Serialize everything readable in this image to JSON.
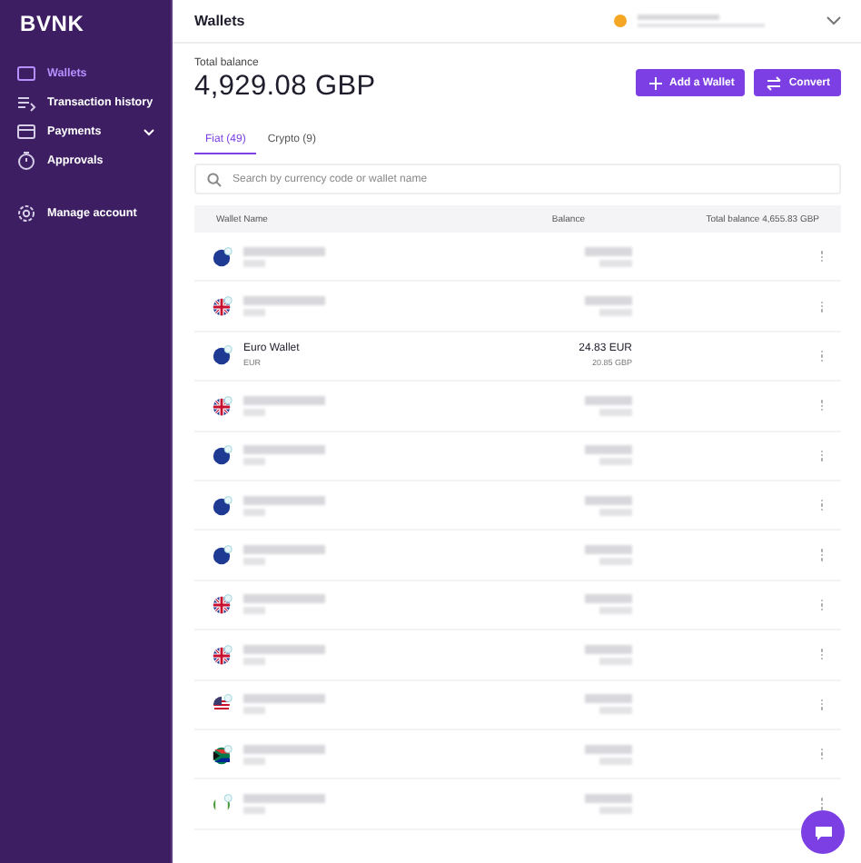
{
  "sidebar": {
    "logo": "BVNK",
    "items": [
      {
        "label": "Wallets",
        "selected": true,
        "expandable": false
      },
      {
        "label": "Transaction history",
        "selected": false,
        "expandable": false
      },
      {
        "label": "Payments",
        "selected": false,
        "expandable": true
      },
      {
        "label": "Approvals",
        "selected": false,
        "expandable": false
      }
    ],
    "footer_items": [
      {
        "label": "Manage account",
        "selected": false,
        "expandable": false
      }
    ]
  },
  "header": {
    "title": "Wallets",
    "account_redacted": true
  },
  "summary": {
    "label": "Total balance",
    "amount": "4,929.08 GBP"
  },
  "buttons": [
    {
      "label": "Add a Wallet"
    },
    {
      "label": "Convert"
    }
  ],
  "tabs": [
    {
      "label": "Fiat (49)",
      "selected": true
    },
    {
      "label": "Crypto (9)",
      "selected": false
    }
  ],
  "search": {
    "placeholder": "Search by currency code or wallet name"
  },
  "table": {
    "columns": [
      "Wallet Name",
      "Balance",
      "Total balance 4,655.83 GBP"
    ],
    "rows": [
      {
        "kind": "eu",
        "redacted": true
      },
      {
        "kind": "uk",
        "redacted": true
      },
      {
        "kind": "eu",
        "redacted": false,
        "name": "Euro Wallet",
        "currency": "EUR",
        "balance": "24.83 EUR",
        "converted": "20.85 GBP"
      },
      {
        "kind": "uk",
        "redacted": true
      },
      {
        "kind": "eu",
        "redacted": true
      },
      {
        "kind": "eu",
        "redacted": true
      },
      {
        "kind": "eu",
        "redacted": true
      },
      {
        "kind": "uk",
        "redacted": true
      },
      {
        "kind": "uk",
        "redacted": true
      },
      {
        "kind": "us",
        "redacted": true
      },
      {
        "kind": "za",
        "redacted": true
      },
      {
        "kind": "ng",
        "redacted": true
      }
    ]
  },
  "chat_button": true
}
